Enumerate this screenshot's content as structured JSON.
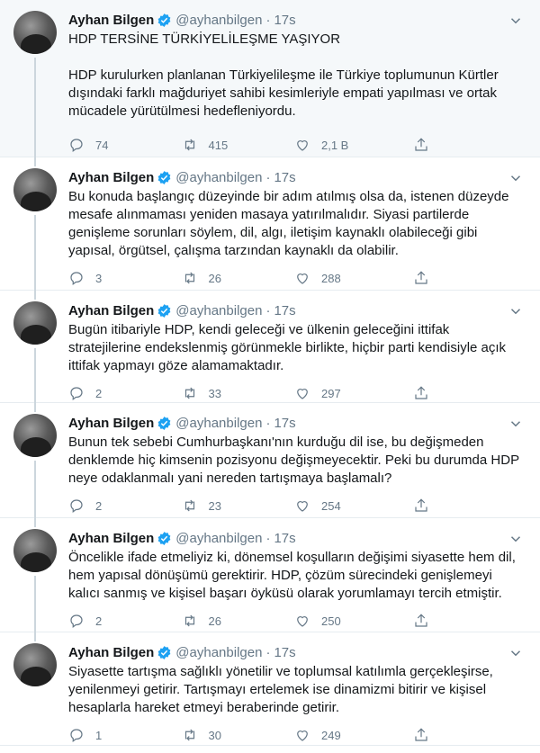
{
  "author": {
    "name": "Ayhan Bilgen",
    "handle": "@ayhanbilgen",
    "time": "17s",
    "separator": "·"
  },
  "tweets": [
    {
      "text": "HDP TERSİNE TÜRKİYELİLEŞME YAŞIYOR\n\nHDP kurulurken planlanan Türkiyelileşme ile Türkiye toplumunun Kürtler dışındaki farklı mağduriyet sahibi kesimleriyle empati yapılması ve ortak mücadele yürütülmesi hedefleniyordu.",
      "replies": "74",
      "retweets": "415",
      "likes": "2,1 B"
    },
    {
      "text": "Bu konuda başlangıç düzeyinde bir adım atılmış olsa da, istenen düzeyde mesafe alınmaması yeniden masaya yatırılmalıdır. Siyasi partilerde genişleme sorunları söylem, dil, algı, iletişim kaynaklı olabileceği gibi yapısal, örgütsel, çalışma tarzından kaynaklı da olabilir.",
      "replies": "3",
      "retweets": "26",
      "likes": "288"
    },
    {
      "text": "Bugün itibariyle HDP, kendi geleceği ve ülkenin geleceğini ittifak stratejilerine endekslenmiş görünmekle birlikte, hiçbir parti kendisiyle açık ittifak yapmayı göze alamamaktadır.",
      "replies": "2",
      "retweets": "33",
      "likes": "297"
    },
    {
      "text": "Bunun tek sebebi Cumhurbaşkanı'nın kurduğu dil ise, bu değişmeden denklemde hiç kimsenin pozisyonu değişmeyecektir. Peki bu durumda HDP neye odaklanmalı yani nereden tartışmaya başlamalı?",
      "replies": "2",
      "retweets": "23",
      "likes": "254"
    },
    {
      "text": "Öncelikle ifade etmeliyiz ki, dönemsel koşulların değişimi siyasette hem dil, hem yapısal dönüşümü gerektirir. HDP, çözüm sürecindeki genişlemeyi kalıcı sanmış ve kişisel başarı öyküsü olarak yorumlamayı tercih etmiştir.",
      "replies": "2",
      "retweets": "26",
      "likes": "250"
    },
    {
      "text": "Siyasette tartışma sağlıklı yönetilir ve toplumsal katılımla gerçekleşirse, yenilenmeyi getirir. Tartışmayı ertelemek ise dinamizmi bitirir ve kişisel hesaplarla hareket etmeyi beraberinde getirir.",
      "replies": "1",
      "retweets": "30",
      "likes": "249"
    }
  ],
  "icons": {
    "verified": "verified-badge-icon",
    "caret": "chevron-down-icon",
    "reply": "reply-icon",
    "retweet": "retweet-icon",
    "like": "heart-icon",
    "share": "share-icon"
  },
  "colors": {
    "verified": "#1da1f2",
    "muted": "#657786",
    "text": "#14171a",
    "thread_line": "#ccd6dd",
    "highlight_bg": "#f5f8fa"
  }
}
